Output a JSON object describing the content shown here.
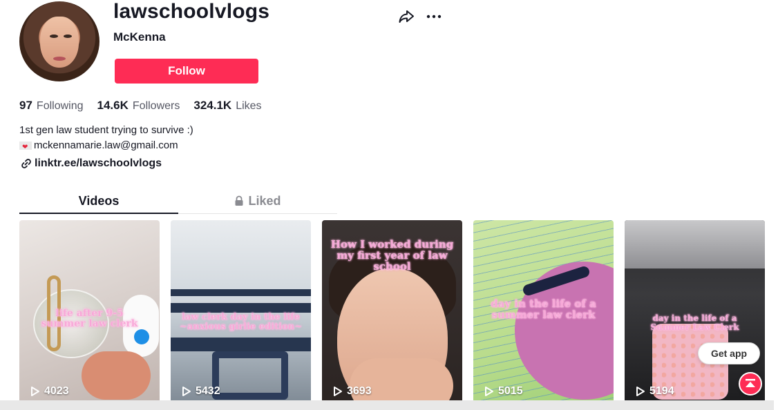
{
  "profile": {
    "username": "lawschoolvlogs",
    "nickname": "McKenna",
    "follow_label": "Follow",
    "stats": [
      {
        "value": "97",
        "label": "Following"
      },
      {
        "value": "14.6K",
        "label": "Followers"
      },
      {
        "value": "324.1K",
        "label": "Likes"
      }
    ],
    "bio_line1": "1st gen law student trying to survive :)",
    "bio_email": "mckennamarie.law@gmail.com",
    "link": "linktr.ee/lawschoolvlogs"
  },
  "tabs": [
    {
      "label": "Videos",
      "active": true
    },
    {
      "label": "Liked",
      "active": false,
      "icon": "lock-icon"
    }
  ],
  "videos": [
    {
      "caption": "life after 9-5\nsummer law clerk",
      "views": "4023"
    },
    {
      "caption": "law clerk day in the life\n~anxious girlie edition~",
      "views": "5432"
    },
    {
      "caption": "How I worked during\nmy first year of law\nschool",
      "views": "3693"
    },
    {
      "caption": "day in the life of a\nsummer law clerk",
      "views": "5015"
    },
    {
      "caption": "day in the life of a\nSummer Law Clerk",
      "views": "5194"
    }
  ],
  "floating": {
    "get_app": "Get app"
  },
  "colors": {
    "accent": "#fe2c55",
    "text": "#161823",
    "caption_pink": "#f8a8d8"
  }
}
